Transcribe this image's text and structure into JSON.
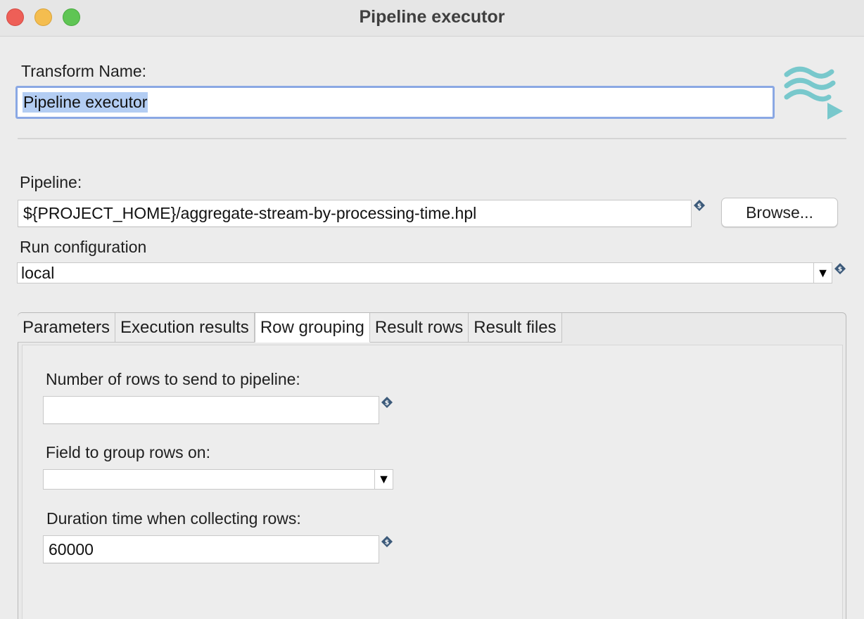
{
  "window": {
    "title": "Pipeline executor"
  },
  "transform": {
    "label": "Transform Name:",
    "value": "Pipeline executor"
  },
  "pipeline": {
    "label": "Pipeline:",
    "value": "${PROJECT_HOME}/aggregate-stream-by-processing-time.hpl",
    "browse_label": "Browse..."
  },
  "run_config": {
    "label": "Run configuration",
    "value": "local"
  },
  "tabs": [
    {
      "label": "Parameters",
      "active": false
    },
    {
      "label": "Execution results",
      "active": false
    },
    {
      "label": "Row grouping",
      "active": true
    },
    {
      "label": "Result rows",
      "active": false
    },
    {
      "label": "Result files",
      "active": false
    }
  ],
  "row_grouping": {
    "rows_label": "Number of rows to send to pipeline:",
    "rows_value": "",
    "group_field_label": "Field to group rows on:",
    "group_field_value": "",
    "duration_label": "Duration time when collecting rows:",
    "duration_value": "60000"
  },
  "icons": {
    "variable": "variable-diamond-icon",
    "logo": "pipeline-executor-logo",
    "dropdown": "triangle-down-icon"
  },
  "colors": {
    "focus": "#8aa8e4",
    "selection": "#b3cdf3",
    "logo": "#5bbfc4"
  }
}
